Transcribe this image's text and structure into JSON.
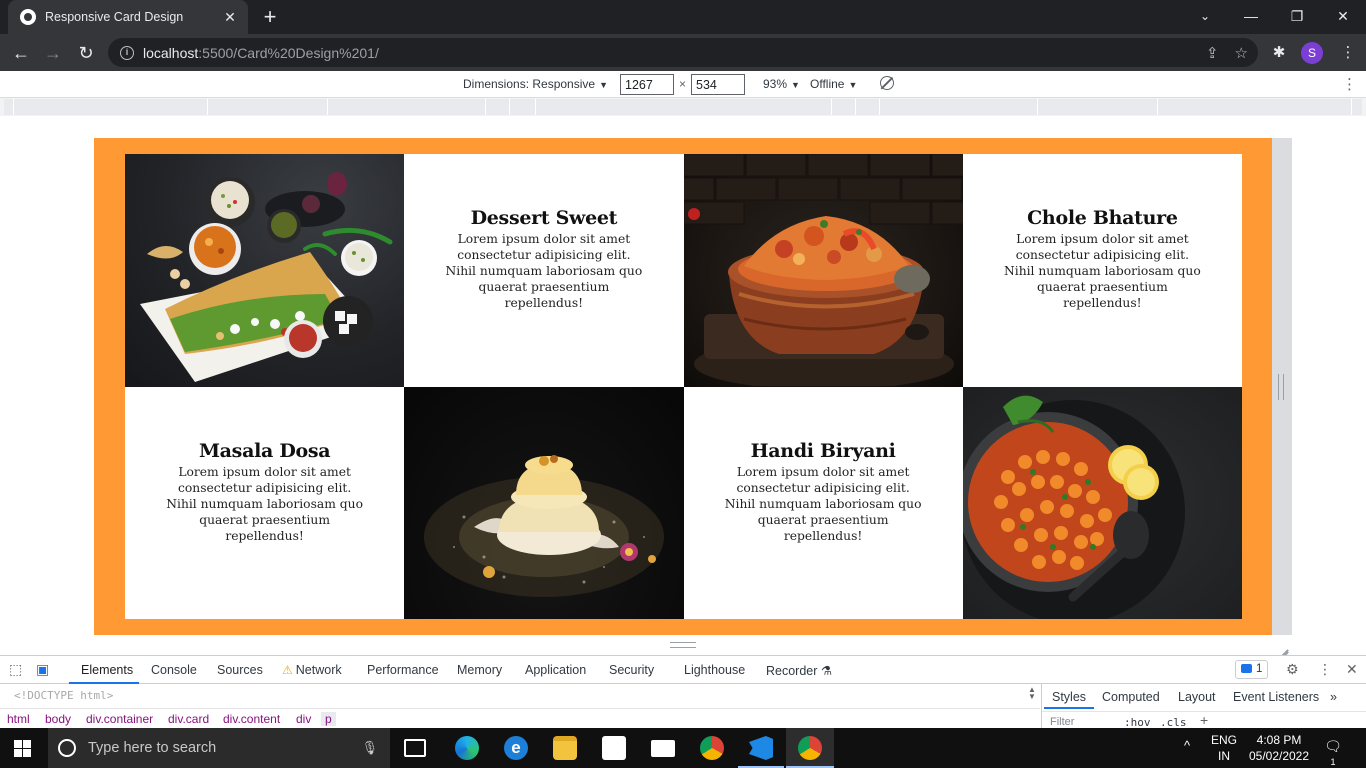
{
  "browser": {
    "tab_title": "Responsive Card Design",
    "url_host": "localhost",
    "url_path": ":5500/Card%20Design%201/",
    "profile_initial": "S"
  },
  "device_toolbar": {
    "dimensions_label": "Dimensions: Responsive",
    "width": "1267",
    "height": "534",
    "times": "×",
    "zoom": "93%",
    "throttle": "Offline"
  },
  "page": {
    "background": "#ff9933",
    "cards": [
      {
        "type": "image",
        "icon": "dosa-platter-image"
      },
      {
        "type": "text",
        "title": "Dessert Sweet",
        "body": "Lorem ipsum dolor sit amet consectetur adipisicing elit. Nihil numquam laboriosam quo quaerat praesentium repellendus!"
      },
      {
        "type": "image",
        "icon": "biryani-handi-image"
      },
      {
        "type": "text",
        "title": "Chole Bhature",
        "body": "Lorem ipsum dolor sit amet consectetur adipisicing elit. Nihil numquam laboriosam quo quaerat praesentium repellendus!"
      },
      {
        "type": "text",
        "title": "Masala Dosa",
        "body": "Lorem ipsum dolor sit amet consectetur adipisicing elit. Nihil numquam laboriosam quo quaerat praesentium repellendus!"
      },
      {
        "type": "image",
        "icon": "dessert-sweet-image"
      },
      {
        "type": "text",
        "title": "Handi Biryani",
        "body": "Lorem ipsum dolor sit amet consectetur adipisicing elit. Nihil numquam laboriosam quo quaerat praesentium repellendus!"
      },
      {
        "type": "image",
        "icon": "chole-bowl-image"
      }
    ]
  },
  "devtools": {
    "tabs": [
      "Elements",
      "Console",
      "Sources",
      "Network",
      "Performance",
      "Memory",
      "Application",
      "Security",
      "Lighthouse",
      "Recorder"
    ],
    "issues_count": "1",
    "doctype": "<!DOCTYPE html>",
    "breadcrumbs": [
      "html",
      "body",
      "div.container",
      "div.card",
      "div.content",
      "div",
      "p"
    ],
    "side_tabs": [
      "Styles",
      "Computed",
      "Layout",
      "Event Listeners"
    ],
    "filter_placeholder": "Filter",
    "hov": ":hov",
    "cls": ".cls"
  },
  "taskbar": {
    "search_placeholder": "Type here to search",
    "lang_top": "ENG",
    "lang_bottom": "IN",
    "time": "4:08 PM",
    "date": "05/02/2022",
    "notification_count": "1"
  }
}
